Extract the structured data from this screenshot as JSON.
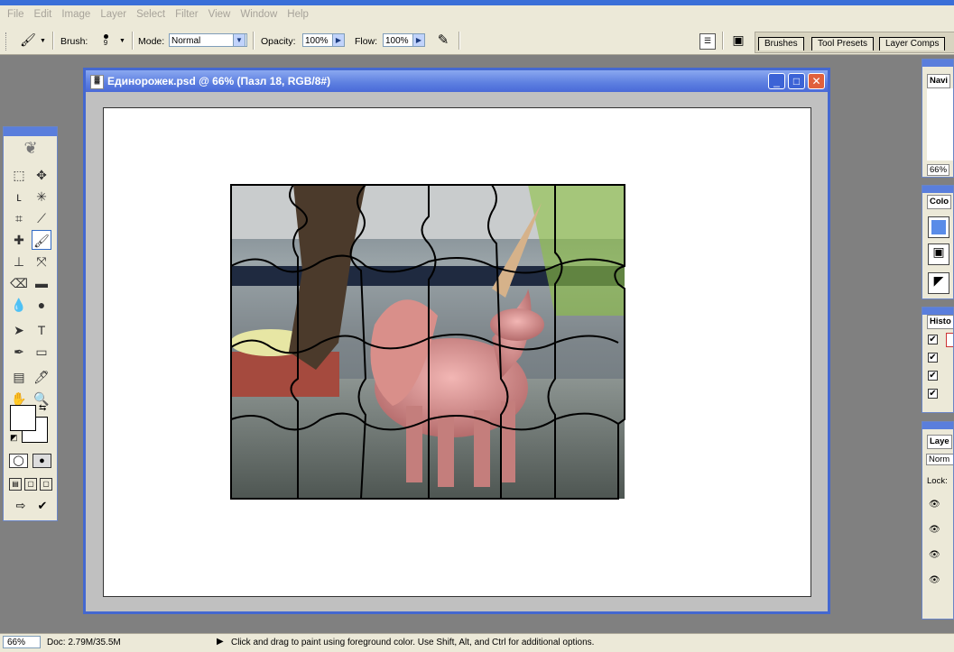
{
  "menu": [
    "File",
    "Edit",
    "Image",
    "Layer",
    "Select",
    "Filter",
    "View",
    "Window",
    "Help"
  ],
  "options": {
    "brush_label": "Brush:",
    "brush_size": "9",
    "mode_label": "Mode:",
    "mode_value": "Normal",
    "opacity_label": "Opacity:",
    "opacity_value": "100%",
    "flow_label": "Flow:",
    "flow_value": "100%"
  },
  "well_tabs": [
    "Brushes",
    "Tool Presets",
    "Layer Comps"
  ],
  "document": {
    "title": "Единорожек.psd @ 66% (Пазл 18, RGB/8#)",
    "minimize": "_",
    "maximize": "□",
    "close": "✕"
  },
  "navigator": {
    "tab": "Navi",
    "zoom": "66%"
  },
  "color_panel": {
    "tab": "Colo"
  },
  "history": {
    "tab": "Histo"
  },
  "layers": {
    "tab": "Laye",
    "blend": "Norm",
    "lock_label": "Lock:"
  },
  "status": {
    "zoom": "66%",
    "doc": "Doc: 2.79M/35.5M",
    "hint": "Click and drag to paint using foreground color.  Use Shift, Alt, and Ctrl for additional options."
  },
  "colors": {
    "accent": "#4468d0",
    "chrome": "#ece9d8",
    "canvas_bg": "#c0c0c0"
  },
  "icons": [
    "brush-icon",
    "move-icon",
    "marquee-icon",
    "lasso-icon",
    "magic-wand-icon",
    "crop-icon",
    "slice-icon",
    "healing-icon",
    "stamp-icon",
    "history-brush-icon",
    "eraser-icon",
    "gradient-icon",
    "blur-icon",
    "dodge-icon",
    "path-select-icon",
    "type-icon",
    "pen-icon",
    "shape-icon",
    "notes-icon",
    "eyedropper-icon",
    "hand-icon",
    "zoom-icon"
  ]
}
